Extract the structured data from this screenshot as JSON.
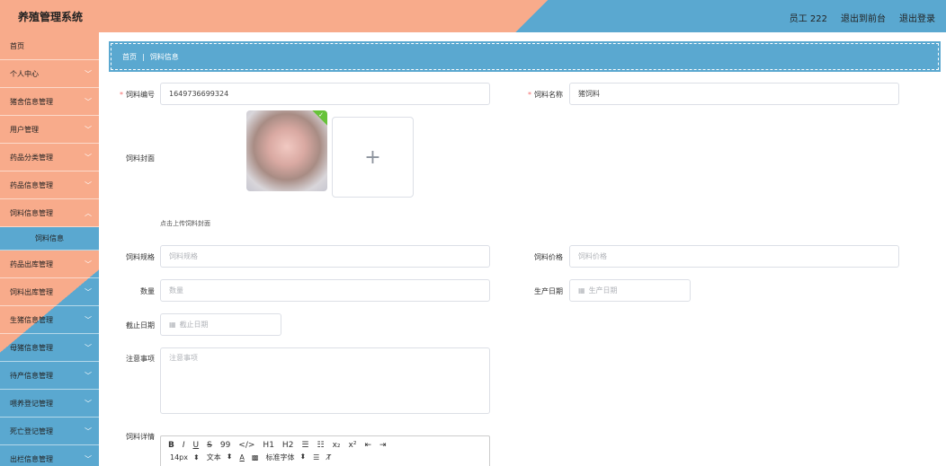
{
  "header": {
    "title": "养殖管理系统",
    "user": "员工 222",
    "back_label": "退出到前台",
    "logout_label": "退出登录"
  },
  "sidebar": {
    "items": [
      {
        "label": "首页",
        "chevron": false
      },
      {
        "label": "个人中心",
        "chevron": true
      },
      {
        "label": "猪舍信息管理",
        "chevron": true
      },
      {
        "label": "用户管理",
        "chevron": true
      },
      {
        "label": "药品分类管理",
        "chevron": true
      },
      {
        "label": "药品信息管理",
        "chevron": true
      },
      {
        "label": "饲料信息管理",
        "chevron": true
      },
      {
        "label": "饲料信息",
        "active": true
      },
      {
        "label": "药品出库管理",
        "chevron": true
      },
      {
        "label": "饲料出库管理",
        "chevron": true
      },
      {
        "label": "生猪信息管理",
        "chevron": true
      },
      {
        "label": "母猪信息管理",
        "chevron": true
      },
      {
        "label": "待产信息管理",
        "chevron": true
      },
      {
        "label": "喂养登记管理",
        "chevron": true
      },
      {
        "label": "死亡登记管理",
        "chevron": true
      },
      {
        "label": "出栏信息管理",
        "chevron": true
      }
    ]
  },
  "breadcrumb": {
    "home": "首页",
    "separator": "|",
    "current": "饲料信息"
  },
  "form": {
    "feed_id": {
      "label": "饲料编号",
      "value": "1649736699324"
    },
    "feed_name": {
      "label": "饲料名称",
      "value": "猪饲料"
    },
    "cover": {
      "label": "饲料封面",
      "add": "+",
      "hint": "点击上传饲料封面"
    },
    "spec": {
      "label": "饲料规格",
      "placeholder": "饲料规格"
    },
    "price": {
      "label": "饲料价格",
      "placeholder": "饲料价格"
    },
    "quantity": {
      "label": "数量",
      "placeholder": "数量"
    },
    "production_date": {
      "label": "生产日期",
      "placeholder": "生产日期"
    },
    "expiry_date": {
      "label": "截止日期",
      "placeholder": "截止日期"
    },
    "notes": {
      "label": "注意事项",
      "placeholder": "注意事项"
    },
    "details": {
      "label": "饲料详情"
    }
  },
  "editor": {
    "toolbar1": [
      "B",
      "I",
      "U",
      "S",
      "99",
      "</>",
      "H1",
      "H2",
      "☰",
      "☷",
      "x₂",
      "x²",
      "⇤",
      "⇥"
    ],
    "font_size": "14px",
    "text_style": "文本",
    "text_color": "A",
    "font_family": "标准字体"
  },
  "colors": {
    "peach": "#f8ab8b",
    "blue": "#5aa8d0",
    "required": "#f56c6c"
  }
}
